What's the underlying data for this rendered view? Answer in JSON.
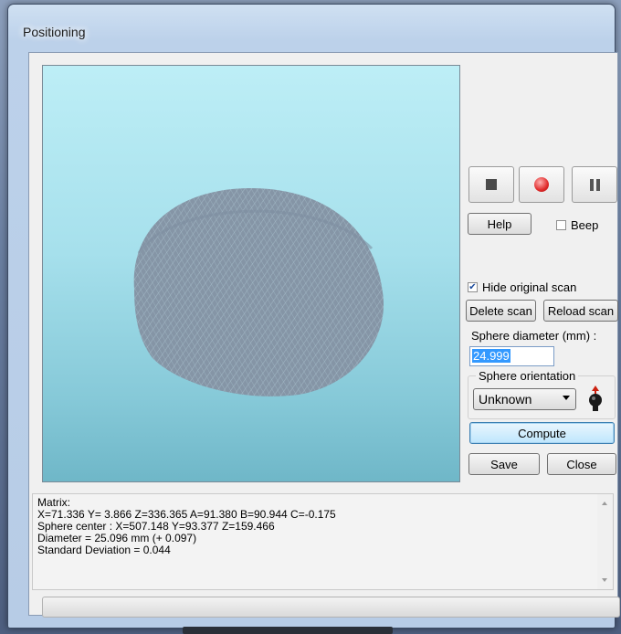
{
  "window": {
    "title": "Positioning"
  },
  "toolbar": {
    "stop_icon": "stop-icon",
    "record_icon": "record-icon",
    "pause_icon": "pause-icon"
  },
  "controls": {
    "help_label": "Help",
    "beep_label": "Beep",
    "beep_checked": false,
    "hide_scan_label": "Hide original scan",
    "hide_scan_checked": true,
    "delete_scan_label": "Delete scan",
    "reload_scan_label": "Reload scan",
    "sphere_diameter_label": "Sphere diameter (mm) :",
    "sphere_diameter_value": "24.999",
    "orientation_group_title": "Sphere orientation",
    "orientation_value": "Unknown",
    "orientation_icon": "sphere-orientation-icon",
    "compute_label": "Compute",
    "save_label": "Save",
    "close_label": "Close"
  },
  "output": {
    "lines": [
      "Matrix:",
      "X=71.336  Y= 3.866  Z=336.365  A=91.380  B=90.944  C=-0.175",
      "Sphere center : X=507.148  Y=93.377  Z=159.466",
      "Diameter = 25.096 mm (+ 0.097)",
      "Standard Deviation =  0.044"
    ]
  },
  "progress": {
    "value": 0
  },
  "colors": {
    "view_top": "#bdeef6",
    "view_bottom": "#6fb7c8",
    "scan_points": "#7f8fa1",
    "selection": "#3399ff"
  }
}
